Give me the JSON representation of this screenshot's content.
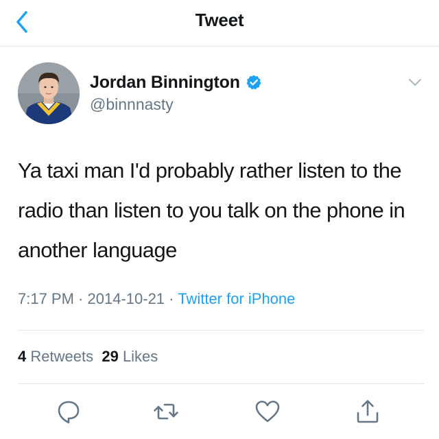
{
  "nav": {
    "title": "Tweet",
    "back_icon": "chevron-left-icon"
  },
  "author": {
    "display_name": "Jordan Binnington",
    "handle": "@binnnasty",
    "verified_icon": "verified-badge-icon"
  },
  "tweet": {
    "text": "Ya taxi man I'd probably rather listen to the radio than listen to you talk on the phone in another language",
    "time": "7:17 PM",
    "date": "2014-10-21",
    "separator": " · ",
    "source": "Twitter for iPhone"
  },
  "stats": {
    "retweets_count": "4",
    "retweets_label": "Retweets",
    "likes_count": "29",
    "likes_label": "Likes"
  },
  "actions": {
    "reply_icon": "reply-icon",
    "retweet_icon": "retweet-icon",
    "like_icon": "heart-icon",
    "share_icon": "share-icon"
  },
  "colors": {
    "accent": "#1da1f2",
    "text": "#14171a",
    "secondary": "#657786",
    "divider": "#e1e8ed"
  }
}
